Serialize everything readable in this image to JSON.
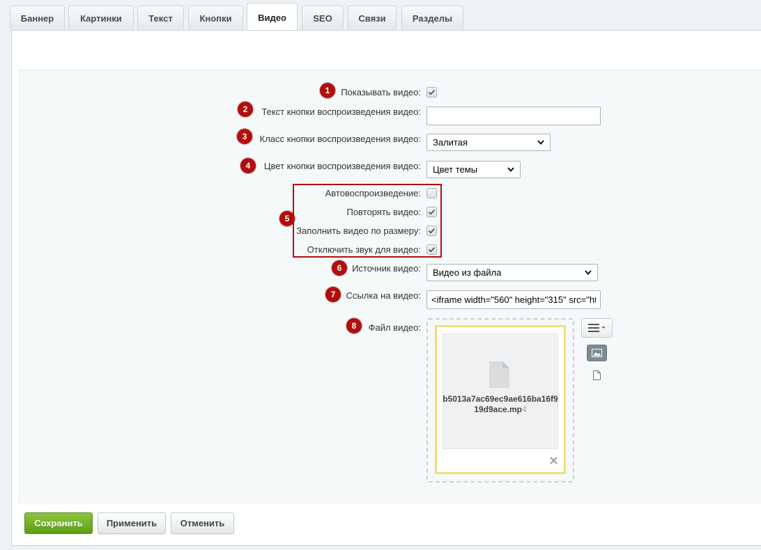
{
  "tabs": [
    {
      "label": "Баннер"
    },
    {
      "label": "Картинки"
    },
    {
      "label": "Текст"
    },
    {
      "label": "Кнопки"
    },
    {
      "label": "Видео"
    },
    {
      "label": "SEO"
    },
    {
      "label": "Связи"
    },
    {
      "label": "Разделы"
    }
  ],
  "active_tab": "Видео",
  "fields": {
    "show_video": {
      "marker": "1",
      "label": "Показывать видео:",
      "checked": true
    },
    "button_text": {
      "marker": "2",
      "label": "Текст кнопки воспроизведения видео:",
      "value": ""
    },
    "button_class": {
      "marker": "3",
      "label": "Класс кнопки воспроизведения видео:",
      "value": "Залитая"
    },
    "button_color": {
      "marker": "4",
      "label": "Цвет кнопки воспроизведения видео:",
      "value": "Цвет темы"
    },
    "group_marker": "5",
    "autoplay": {
      "label": "Автовоспроизведение:",
      "checked": false
    },
    "loop": {
      "label": "Повторять видео:",
      "checked": true
    },
    "fill": {
      "label": "Заполнить видео по размеру:",
      "checked": true
    },
    "mute": {
      "label": "Отключить звук для видео:",
      "checked": true
    },
    "source": {
      "marker": "6",
      "label": "Источник видео:",
      "value": "Видео из файла"
    },
    "link": {
      "marker": "7",
      "label": "Ссылка на видео:",
      "value": "<iframe width=\"560\" height=\"315\" src=\"ht"
    },
    "file": {
      "marker": "8",
      "label": "Файл видео:",
      "name_main": "b5013a7ac69ec9ae616ba16f919d9ace.mp",
      "name_ext": "4"
    }
  },
  "icons": {
    "checkbox": "check-icon",
    "dropdown": "chevron-down-icon",
    "file_doc": "document-icon",
    "menu": "hamburger-menu-icon",
    "image": "image-icon",
    "remove": "close-icon"
  },
  "buttons": {
    "save": "Сохранить",
    "apply": "Применить",
    "cancel": "Отменить"
  },
  "colors": {
    "marker": "#b20e0e",
    "save_button": "#6aab1f",
    "file_card_border": "#f3de7b"
  }
}
